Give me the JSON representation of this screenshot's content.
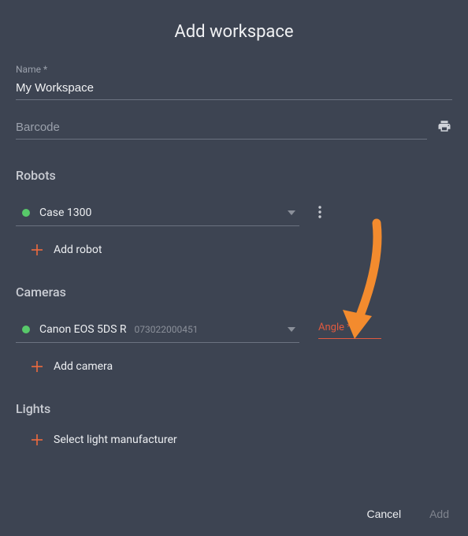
{
  "title": "Add workspace",
  "name": {
    "label": "Name *",
    "value": "My Workspace"
  },
  "barcode": {
    "placeholder": "Barcode",
    "value": ""
  },
  "sections": {
    "robots": {
      "header": "Robots",
      "items": [
        {
          "label": "Case 1300",
          "status": "online"
        }
      ],
      "addLabel": "Add robot"
    },
    "cameras": {
      "header": "Cameras",
      "items": [
        {
          "label": "Canon EOS 5DS R",
          "serial": "073022000451",
          "status": "online"
        }
      ],
      "angle": {
        "label": "Angle *"
      },
      "addLabel": "Add camera"
    },
    "lights": {
      "header": "Lights",
      "addLabel": "Select light manufacturer"
    }
  },
  "footer": {
    "cancel": "Cancel",
    "add": "Add"
  },
  "colors": {
    "accent": "#ee6b3e",
    "error": "#e05a3f",
    "status_online": "#58c96a"
  }
}
